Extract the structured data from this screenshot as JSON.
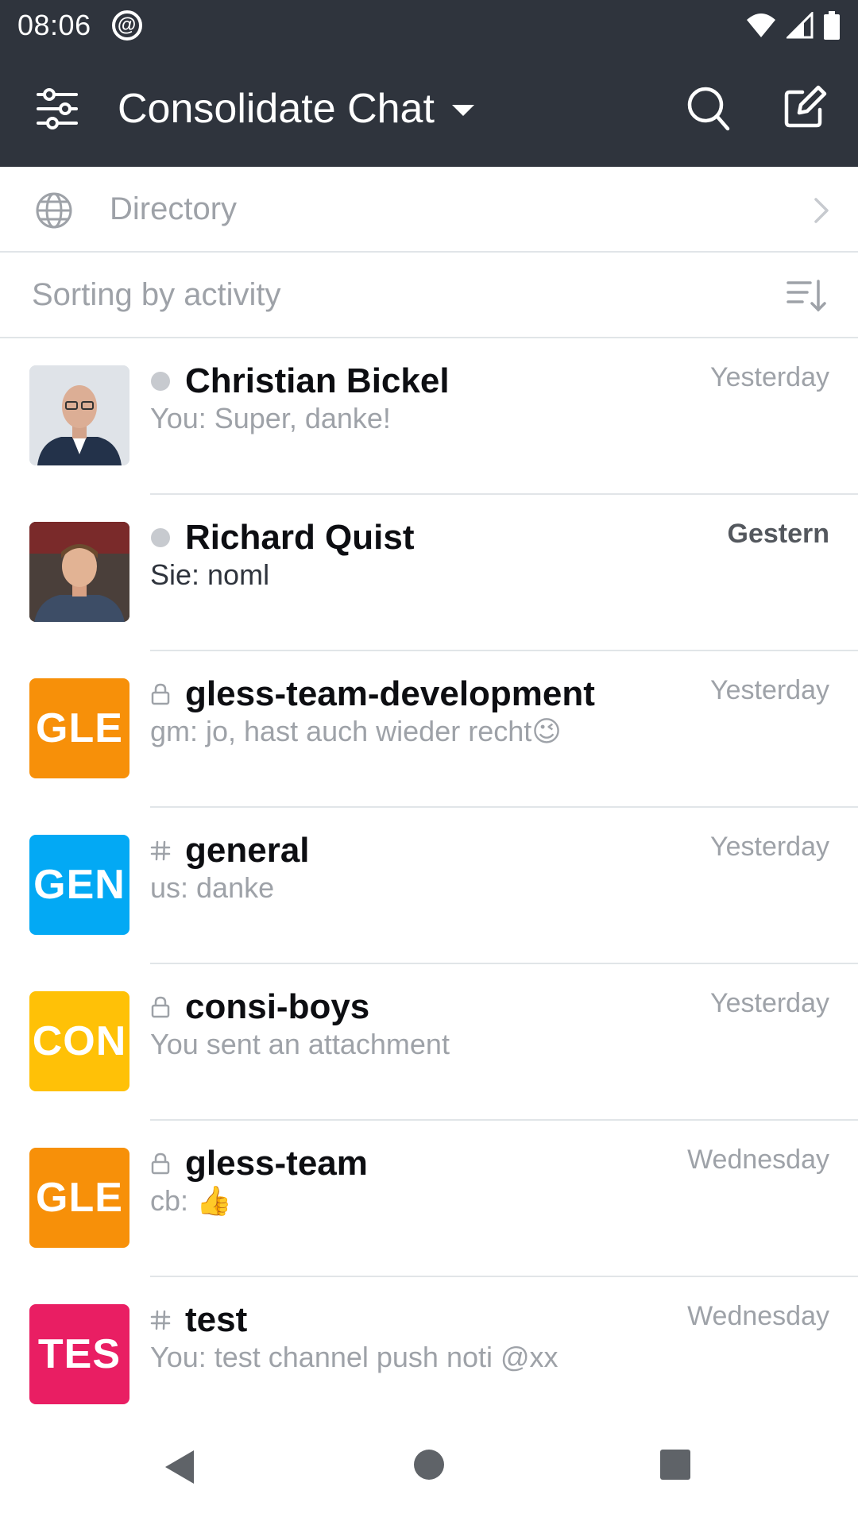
{
  "status_bar": {
    "time": "08:06",
    "at_symbol": "@"
  },
  "header": {
    "title": "Consolidate Chat",
    "menu_icon": "sliders-icon",
    "search_icon": "search-icon",
    "compose_icon": "edit-icon"
  },
  "directory": {
    "label": "Directory",
    "icon": "globe-icon"
  },
  "sorting": {
    "label": "Sorting by activity",
    "icon": "sort-icon"
  },
  "rooms": [
    {
      "name": "Christian  Bickel",
      "last_message": "You: Super, danke!",
      "time": "Yesterday",
      "type": "direct",
      "avatar_text": "",
      "avatar_color": "#5a6a7a",
      "unread": false
    },
    {
      "name": "Richard Quist",
      "last_message": "Sie: noml",
      "time": "Gestern",
      "type": "direct",
      "avatar_text": "",
      "avatar_color": "#4a4038",
      "unread": true
    },
    {
      "name": "gless-team-development",
      "last_message": "gm: jo, hast auch wieder recht😉",
      "time": "Yesterday",
      "type": "private",
      "avatar_text": "GLE",
      "avatar_color": "#f79009",
      "unread": false
    },
    {
      "name": "general",
      "last_message": "us: danke",
      "time": "Yesterday",
      "type": "channel",
      "avatar_text": "GEN",
      "avatar_color": "#03a9f4",
      "unread": false
    },
    {
      "name": "consi-boys",
      "last_message": "You sent an attachment",
      "time": "Yesterday",
      "type": "private",
      "avatar_text": "CON",
      "avatar_color": "#ffc107",
      "unread": false
    },
    {
      "name": "gless-team",
      "last_message": "cb: 👍",
      "time": "Wednesday",
      "type": "private",
      "avatar_text": "GLE",
      "avatar_color": "#f79009",
      "unread": false
    },
    {
      "name": "test",
      "last_message": "You: test channel push noti @xx",
      "time": "Wednesday",
      "type": "channel",
      "avatar_text": "TES",
      "avatar_color": "#e91e63",
      "unread": false
    }
  ],
  "nav": {
    "back_icon": "back-triangle-icon",
    "home_icon": "home-circle-icon",
    "recents_icon": "recents-square-icon"
  }
}
